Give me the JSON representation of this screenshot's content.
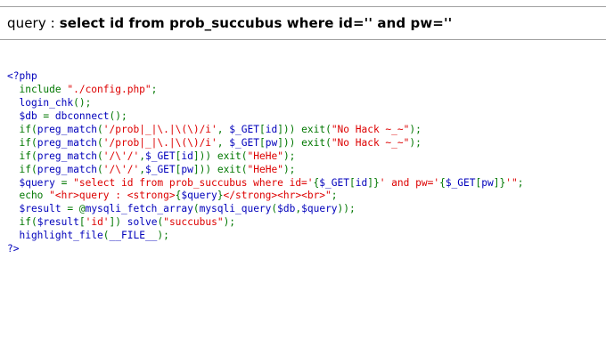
{
  "query_header": {
    "prefix": "query : ",
    "query_text": "select id from prob_succubus where id='' and pw=''"
  },
  "source_code": {
    "lines": [
      [
        {
          "t": "<?php",
          "c": "default"
        }
      ],
      [
        {
          "t": "  include ",
          "c": "keyword"
        },
        {
          "t": "\"./config.php\"",
          "c": "string"
        },
        {
          "t": ";",
          "c": "keyword"
        }
      ],
      [
        {
          "t": "  login_chk",
          "c": "default"
        },
        {
          "t": "();",
          "c": "keyword"
        }
      ],
      [
        {
          "t": "  $db ",
          "c": "default"
        },
        {
          "t": "= ",
          "c": "keyword"
        },
        {
          "t": "dbconnect",
          "c": "default"
        },
        {
          "t": "();",
          "c": "keyword"
        }
      ],
      [
        {
          "t": "  if(",
          "c": "keyword"
        },
        {
          "t": "preg_match",
          "c": "default"
        },
        {
          "t": "(",
          "c": "keyword"
        },
        {
          "t": "'/prob|_|\\.|\\(\\)/i'",
          "c": "string"
        },
        {
          "t": ", ",
          "c": "keyword"
        },
        {
          "t": "$_GET",
          "c": "default"
        },
        {
          "t": "[",
          "c": "keyword"
        },
        {
          "t": "id",
          "c": "default"
        },
        {
          "t": "])) exit(",
          "c": "keyword"
        },
        {
          "t": "\"No Hack ~_~\"",
          "c": "string"
        },
        {
          "t": ");",
          "c": "keyword"
        }
      ],
      [
        {
          "t": "  if(",
          "c": "keyword"
        },
        {
          "t": "preg_match",
          "c": "default"
        },
        {
          "t": "(",
          "c": "keyword"
        },
        {
          "t": "'/prob|_|\\.|\\(\\)/i'",
          "c": "string"
        },
        {
          "t": ", ",
          "c": "keyword"
        },
        {
          "t": "$_GET",
          "c": "default"
        },
        {
          "t": "[",
          "c": "keyword"
        },
        {
          "t": "pw",
          "c": "default"
        },
        {
          "t": "])) exit(",
          "c": "keyword"
        },
        {
          "t": "\"No Hack ~_~\"",
          "c": "string"
        },
        {
          "t": ");",
          "c": "keyword"
        }
      ],
      [
        {
          "t": "  if(",
          "c": "keyword"
        },
        {
          "t": "preg_match",
          "c": "default"
        },
        {
          "t": "(",
          "c": "keyword"
        },
        {
          "t": "'/\\'/'",
          "c": "string"
        },
        {
          "t": ",",
          "c": "keyword"
        },
        {
          "t": "$_GET",
          "c": "default"
        },
        {
          "t": "[",
          "c": "keyword"
        },
        {
          "t": "id",
          "c": "default"
        },
        {
          "t": "])) exit(",
          "c": "keyword"
        },
        {
          "t": "\"HeHe\"",
          "c": "string"
        },
        {
          "t": ");",
          "c": "keyword"
        }
      ],
      [
        {
          "t": "  if(",
          "c": "keyword"
        },
        {
          "t": "preg_match",
          "c": "default"
        },
        {
          "t": "(",
          "c": "keyword"
        },
        {
          "t": "'/\\'/'",
          "c": "string"
        },
        {
          "t": ",",
          "c": "keyword"
        },
        {
          "t": "$_GET",
          "c": "default"
        },
        {
          "t": "[",
          "c": "keyword"
        },
        {
          "t": "pw",
          "c": "default"
        },
        {
          "t": "])) exit(",
          "c": "keyword"
        },
        {
          "t": "\"HeHe\"",
          "c": "string"
        },
        {
          "t": ");",
          "c": "keyword"
        }
      ],
      [
        {
          "t": "  $query ",
          "c": "default"
        },
        {
          "t": "= ",
          "c": "keyword"
        },
        {
          "t": "\"select id from prob_succubus where id='",
          "c": "string"
        },
        {
          "t": "{",
          "c": "keyword"
        },
        {
          "t": "$_GET",
          "c": "default"
        },
        {
          "t": "[",
          "c": "keyword"
        },
        {
          "t": "id",
          "c": "default"
        },
        {
          "t": "]",
          "c": "keyword"
        },
        {
          "t": "}",
          "c": "keyword"
        },
        {
          "t": "' and pw='",
          "c": "string"
        },
        {
          "t": "{",
          "c": "keyword"
        },
        {
          "t": "$_GET",
          "c": "default"
        },
        {
          "t": "[",
          "c": "keyword"
        },
        {
          "t": "pw",
          "c": "default"
        },
        {
          "t": "]",
          "c": "keyword"
        },
        {
          "t": "}",
          "c": "keyword"
        },
        {
          "t": "'\"",
          "c": "string"
        },
        {
          "t": ";",
          "c": "keyword"
        }
      ],
      [
        {
          "t": "  echo ",
          "c": "keyword"
        },
        {
          "t": "\"<hr>query : <strong>",
          "c": "string"
        },
        {
          "t": "{",
          "c": "keyword"
        },
        {
          "t": "$query",
          "c": "default"
        },
        {
          "t": "}",
          "c": "keyword"
        },
        {
          "t": "</strong><hr><br>\"",
          "c": "string"
        },
        {
          "t": ";",
          "c": "keyword"
        }
      ],
      [
        {
          "t": "  $result ",
          "c": "default"
        },
        {
          "t": "= @",
          "c": "keyword"
        },
        {
          "t": "mysqli_fetch_array",
          "c": "default"
        },
        {
          "t": "(",
          "c": "keyword"
        },
        {
          "t": "mysqli_query",
          "c": "default"
        },
        {
          "t": "(",
          "c": "keyword"
        },
        {
          "t": "$db",
          "c": "default"
        },
        {
          "t": ",",
          "c": "keyword"
        },
        {
          "t": "$query",
          "c": "default"
        },
        {
          "t": "));",
          "c": "keyword"
        }
      ],
      [
        {
          "t": "  if(",
          "c": "keyword"
        },
        {
          "t": "$result",
          "c": "default"
        },
        {
          "t": "[",
          "c": "keyword"
        },
        {
          "t": "'id'",
          "c": "string"
        },
        {
          "t": "]) ",
          "c": "keyword"
        },
        {
          "t": "solve",
          "c": "default"
        },
        {
          "t": "(",
          "c": "keyword"
        },
        {
          "t": "\"succubus\"",
          "c": "string"
        },
        {
          "t": ");",
          "c": "keyword"
        }
      ],
      [
        {
          "t": "  highlight_file",
          "c": "default"
        },
        {
          "t": "(",
          "c": "keyword"
        },
        {
          "t": "__FILE__",
          "c": "default"
        },
        {
          "t": ");",
          "c": "keyword"
        }
      ],
      [
        {
          "t": "?>",
          "c": "default"
        }
      ]
    ]
  }
}
